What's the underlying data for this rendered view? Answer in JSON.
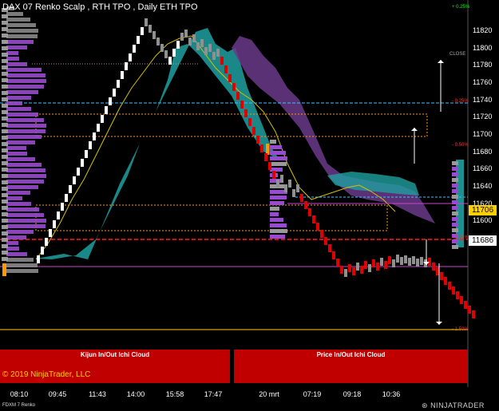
{
  "header": {
    "title": "DAX 07 Renko Scalp , RTH TPO , Daily ETH TPO"
  },
  "price_axis": {
    "ticks": [
      "11820",
      "11800",
      "11780",
      "11760",
      "11740",
      "11720",
      "11700",
      "11680",
      "11660",
      "11640",
      "11620",
      "11600"
    ],
    "current_price_tag": "11706",
    "last_price_tag": "11686",
    "pct_labels": [
      "+ 0.25%",
      "- 0.25%",
      "- 0.50%",
      "- 1.00%",
      "- 1.50%"
    ]
  },
  "time_axis": {
    "ticks": [
      "08:10",
      "09:45",
      "11:43",
      "14:00",
      "15:58",
      "17:47",
      "20 mrt",
      "07:19",
      "09:18",
      "10:36"
    ]
  },
  "panels": {
    "left_label": "Kijun In/Out Ichi Cloud",
    "right_label": "Price In/Out Ichi Cloud"
  },
  "footer": {
    "copyright": "© 2019 NinjaTrader, LLC",
    "instrument": "FDXM 7 Renko",
    "logo": "NINJATRADER"
  },
  "chart_labels": {
    "close": "CLOSE"
  },
  "colors": {
    "up_brick": "#ffffff",
    "down_brick": "#e00000",
    "gray_brick": "#909090",
    "cloud_bull": "#1fa0a0",
    "cloud_bear": "#6a3a8a",
    "kijun": "#d4c000",
    "profile": "#9a4ad0",
    "value_box": "#ff9900",
    "panel_red": "#c00000",
    "pct_pos": "#00ff00",
    "pct_neg": "#ff3030"
  }
}
